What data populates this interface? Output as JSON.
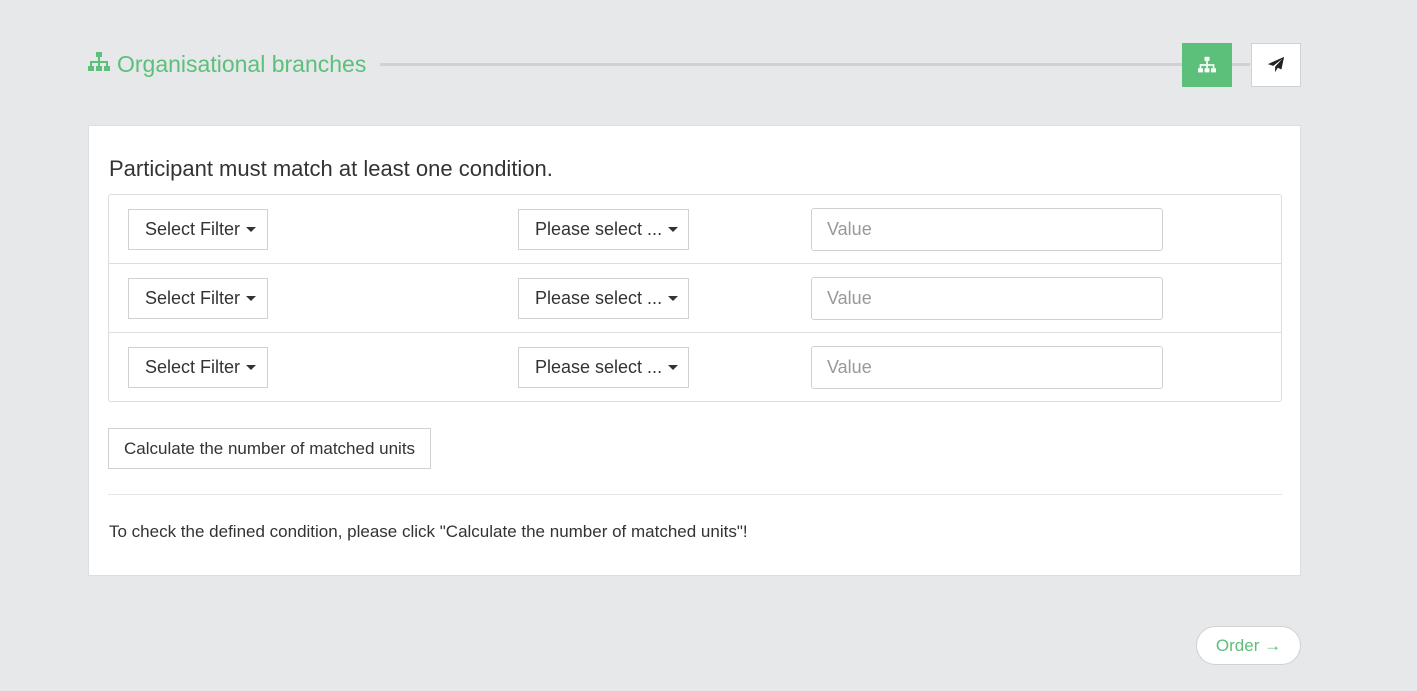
{
  "header": {
    "title": "Organisational branches",
    "icon": "sitemap-icon",
    "accent_color": "#5cc07a",
    "steps": [
      {
        "icon": "sitemap-icon",
        "active": true
      },
      {
        "icon": "paper-plane-icon",
        "active": false
      }
    ]
  },
  "panel": {
    "heading": "Participant must match at least one condition.",
    "conditions": [
      {
        "filter_label": "Select Filter",
        "operator_label": "Please select ...",
        "value_placeholder": "Value",
        "value": ""
      },
      {
        "filter_label": "Select Filter",
        "operator_label": "Please select ...",
        "value_placeholder": "Value",
        "value": ""
      },
      {
        "filter_label": "Select Filter",
        "operator_label": "Please select ...",
        "value_placeholder": "Value",
        "value": ""
      }
    ],
    "calculate_label": "Calculate the number of matched units",
    "hint": "To check the defined condition, please click \"Calculate the number of matched units\"!"
  },
  "footer": {
    "order_label": "Order →"
  }
}
